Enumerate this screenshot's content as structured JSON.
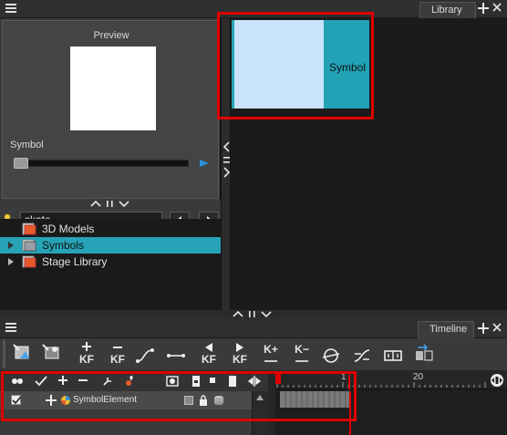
{
  "library": {
    "tab_label": "Library",
    "preview_label": "Preview",
    "symbol_label": "Symbol",
    "search_value": "skate",
    "tree": [
      {
        "label": "3D Models",
        "expandable": false,
        "selected": false
      },
      {
        "label": "Symbols",
        "expandable": true,
        "selected": true
      },
      {
        "label": "Stage Library",
        "expandable": true,
        "selected": false
      }
    ],
    "thumbnail_label": "Symbol"
  },
  "timeline": {
    "tab_label": "Timeline",
    "toolbar_kf_label": "KF",
    "toolbar_kplus_label": "K+",
    "toolbar_kminus_label": "K−",
    "layer_name": "SymbolElement",
    "ruler": [
      "1",
      "20"
    ]
  },
  "colors": {
    "accent": "#27a3b7",
    "highlight_box": "#e00000"
  }
}
